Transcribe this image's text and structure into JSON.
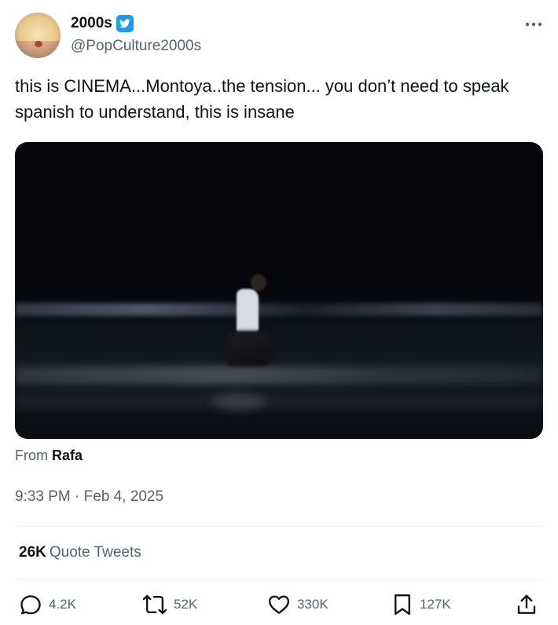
{
  "author": {
    "display_name": "2000s",
    "handle": "@PopCulture2000s",
    "verified": true,
    "verified_color": "#1d9bf0"
  },
  "tweet": {
    "text": "this is CINEMA...Montoya..the tension... you don’t need to speak spanish to understand, this is insane",
    "from_label": "From",
    "from_source": "Rafa",
    "timestamp": "9:33 PM · Feb 4, 2025"
  },
  "stats": {
    "quote_count": "26K",
    "quote_label": "Quote Tweets"
  },
  "actions": {
    "reply_count": "4.2K",
    "retweet_count": "52K",
    "like_count": "330K",
    "bookmark_count": "127K"
  },
  "icons": {
    "more": "more-icon",
    "verified": "verified-badge-icon",
    "reply": "reply-icon",
    "retweet": "retweet-icon",
    "like": "heart-icon",
    "bookmark": "bookmark-icon",
    "share": "share-icon"
  },
  "colors": {
    "text_primary": "#0f1419",
    "text_secondary": "#536471",
    "divider": "#eff3f4"
  }
}
